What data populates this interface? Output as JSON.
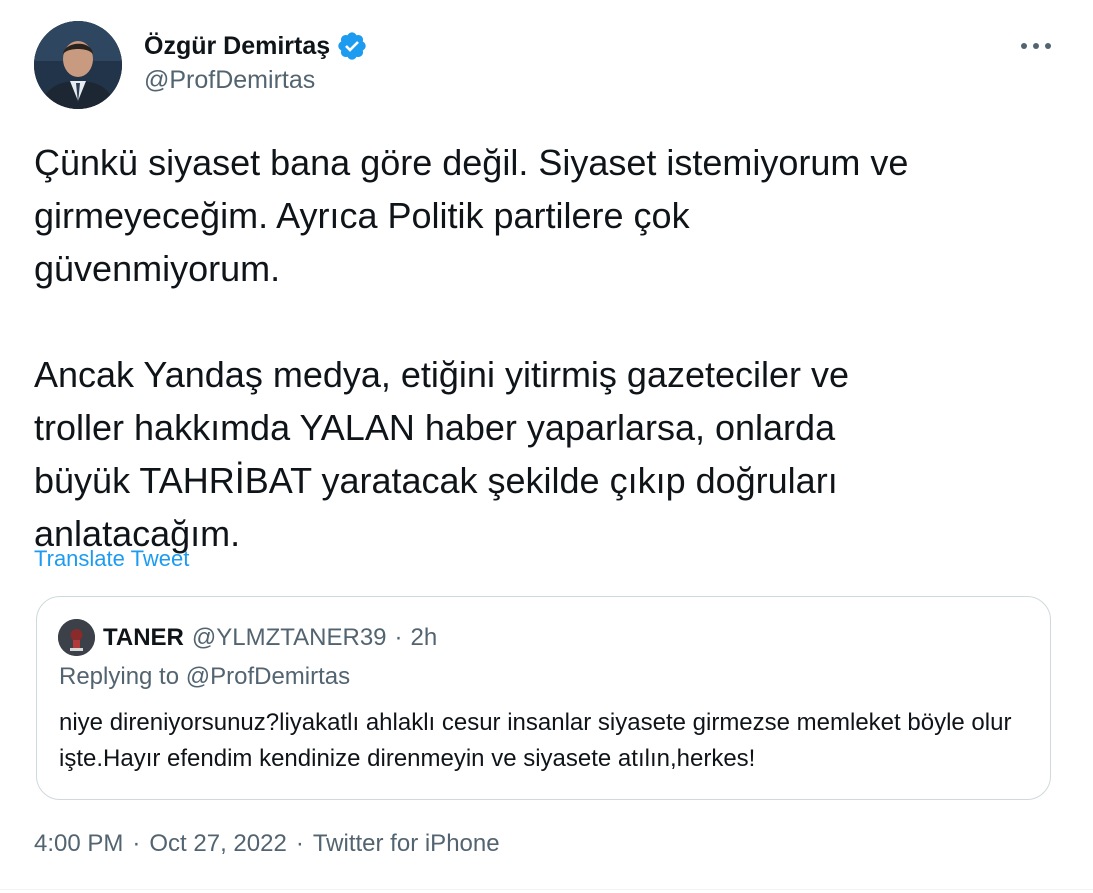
{
  "author": {
    "name": "Özgür Demirtaş",
    "handle": "@ProfDemirtas",
    "avatar_icon": "profile-photo",
    "verified_icon": "verified-badge-icon",
    "verified_color": "#1d9bf0"
  },
  "more_icon": "more-horizontal-icon",
  "tweet": {
    "paragraph_1": "Çünkü siyaset bana göre değil. Siyaset istemiyorum ve\ngirmeyeceğim. Ayrıca Politik partilere çok\ngüvenmiyorum.",
    "paragraph_2": "Ancak Yandaş medya, etiğini yitirmiş gazeteciler ve\ntroller hakkımda YALAN haber yaparlarsa, onlarda\nbüyük TAHRİBAT yaratacak şekilde çıkıp doğruları\nanlatacağım."
  },
  "translate_label": "Translate Tweet",
  "quote": {
    "name": "TANER",
    "handle": "@YLMZTANER39",
    "separator": "·",
    "time": "2h",
    "replying_to": "Replying to @ProfDemirtas",
    "text": "niye direniyorsunuz?liyakatlı ahlaklı cesur insanlar siyasete girmezse memleket böyle olur işte.Hayır efendim kendinize direnmeyin ve siyasete atılın,herkes!"
  },
  "meta": {
    "time": "4:00 PM",
    "separator": "·",
    "date": "Oct 27, 2022",
    "source": "Twitter for iPhone"
  },
  "colors": {
    "text": "#0f1419",
    "secondary": "#536471",
    "link": "#1d9bf0",
    "border": "#cfd9de"
  }
}
